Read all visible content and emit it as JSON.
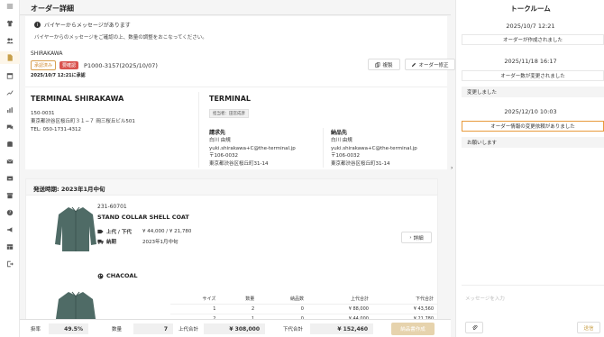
{
  "page": {
    "title": "オーダー詳細"
  },
  "notice": {
    "title": "バイヤーからメッセージがあります",
    "body": "バイヤーからのメッセージをご確認の上、数量の調整をおこなってください。"
  },
  "order": {
    "brand": "SHIRAKAWA",
    "badge_confirmed": "承認済み",
    "badge_change": "要確認",
    "order_number": "P1000-3157(2025/10/07)",
    "approved_at": "2025/10/7 12:21に承認",
    "copy_label": "複製",
    "edit_label": "オーダー修正"
  },
  "shipping_address": {
    "title": "TERMINAL SHIRAKAWA",
    "lines": [
      "150-0031",
      "東京都渋谷区桜丘町３１−７ 岡三桜丘ビル501",
      "TEL: 050-1731-4312"
    ]
  },
  "customer": {
    "title": "TERMINAL",
    "person_tag": "担当者：田宮成彦",
    "billing": {
      "title": "請求先",
      "lines": [
        "白川 由規",
        "yuki.shirakawa+C@the-terminal.jp",
        "〒106-0032",
        "東京都渋谷区桜丘町31-14"
      ]
    },
    "delivery": {
      "title": "納品先",
      "lines": [
        "白川 由規",
        "yuki.shirakawa+C@the-terminal.jp",
        "〒106-0032",
        "東京都渋谷区桜丘町31-14"
      ]
    }
  },
  "shipment": {
    "period": "発送時期: 2023年1月中旬",
    "product": {
      "code": "231-60701",
      "name": "STAND COLLAR SHELL COAT",
      "price_label": "上代 / 下代",
      "price_value": "¥ 44,000 / ¥ 21,780",
      "delivery_label": "納期",
      "delivery_value": "2023年1月中旬",
      "detail_label": "詳細"
    },
    "color": "CHACOAL",
    "size_table": {
      "headers": [
        "サイズ",
        "数量",
        "納品数",
        "上代合計",
        "下代合計"
      ],
      "rows": [
        [
          "1",
          "2",
          "0",
          "¥ 88,000",
          "¥ 43,560"
        ],
        [
          "2",
          "1",
          "0",
          "¥ 44,000",
          "¥ 21,780"
        ]
      ]
    }
  },
  "footer": {
    "rate_label": "掛率",
    "rate_value": "49.5%",
    "qty_label": "数量",
    "qty_value": "7",
    "retail_label": "上代合計",
    "retail_value": "¥ 308,000",
    "wholesale_label": "下代合計",
    "wholesale_value": "¥ 152,460",
    "create_label": "納品書作成"
  },
  "talk": {
    "title": "トークルーム",
    "entries": [
      {
        "date": "2025/10/7 12:21",
        "system": "オーダーが作成されました"
      },
      {
        "date": "2025/11/18 16:17",
        "system": "オーダー数が変更されました",
        "message": "変更しました"
      },
      {
        "date": "2025/12/10 10:03",
        "system": "オーダー情報の変更依頼がありました",
        "message": "お願いします"
      }
    ],
    "input_placeholder": "メッセージを入力",
    "send_label": "送信"
  },
  "colors": {
    "accent": "#c8a04a",
    "highlight": "#e89a3c",
    "badge_red": "#d9534f"
  }
}
